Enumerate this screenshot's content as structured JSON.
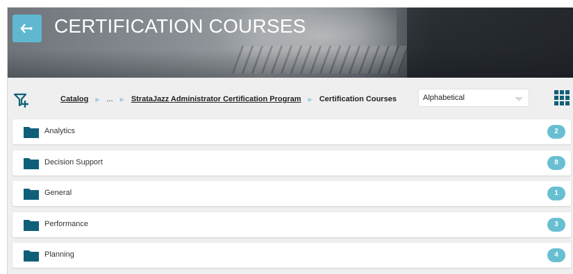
{
  "header": {
    "title": "CERTIFICATION COURSES",
    "back_icon": "back-arrow-icon"
  },
  "breadcrumb": {
    "items": [
      "Catalog",
      "...",
      "StrataJazz Administrator Certification Program"
    ],
    "current": "Certification Courses"
  },
  "toolbar": {
    "filter_icon": "filter-add-icon",
    "sort_value": "Alphabetical",
    "view_icon": "grid-view-icon"
  },
  "folders": [
    {
      "label": "Analytics",
      "count": "2"
    },
    {
      "label": "Decision Support",
      "count": "8"
    },
    {
      "label": "General",
      "count": "1"
    },
    {
      "label": "Performance",
      "count": "3"
    },
    {
      "label": "Planning",
      "count": "4"
    }
  ],
  "colors": {
    "accent": "#5fb8d0",
    "folder": "#0f5f78",
    "badge": "#69bfd2"
  }
}
